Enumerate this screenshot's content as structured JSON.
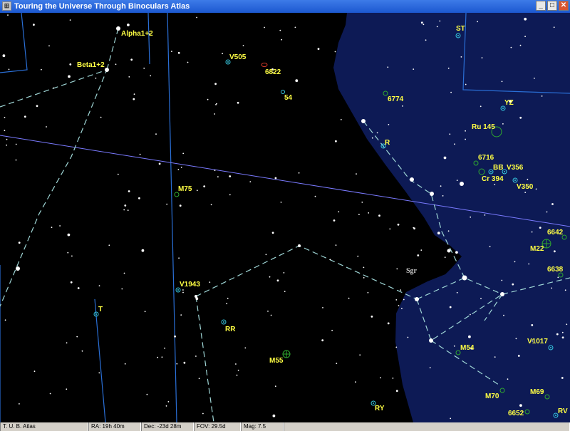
{
  "window": {
    "title": "Touring the Universe Through Binoculars Atlas",
    "buttons": [
      "_",
      "□",
      "✕"
    ]
  },
  "status": {
    "app": "T. U. B. Atlas",
    "ra": "RA: 19h 40m",
    "dec": "Dec: -23d 28m",
    "fov": "FOV: 29.5d",
    "mag": "Mag: 7.5"
  },
  "labels": {
    "alpha": "Alpha1+2",
    "beta": "Beta1+2",
    "v505": "V505",
    "n6822": "6822",
    "n54": "54",
    "st": "ST",
    "n6774": "6774",
    "yz": "YZ",
    "ru145": "Ru 145",
    "r": "R",
    "n6716": "6716",
    "bb": "BB",
    "v356": "V356",
    "cr394": "Cr 394",
    "v350": "V350",
    "m75": "M75",
    "n6642": "6642",
    "m22": "M22",
    "sgr": "Sgr",
    "n6638": "6638",
    "v1943": "V1943",
    "t": "T",
    "rr": "RR",
    "m54": "M54",
    "v1017": "V1017",
    "m55": "M55",
    "m70": "M70",
    "m69": "M69",
    "ry": "RY",
    "n6652": "6652",
    "rv": "RV"
  },
  "colors": {
    "sky": "#000000",
    "milky_way": "#0d1a55",
    "boundary": "#2a6fd6",
    "figure": "#9fd6d6",
    "ecliptic": "#7a7aff",
    "label": "#ffff44",
    "cluster": "#2faa2f",
    "variable": "#36c8e0"
  }
}
